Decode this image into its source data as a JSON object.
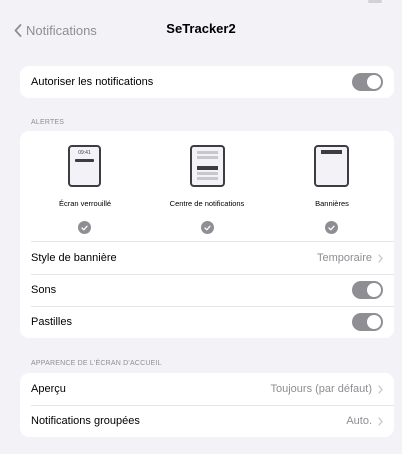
{
  "nav": {
    "back_label": "Notifications",
    "title": "SeTracker2"
  },
  "allow": {
    "label": "Autoriser les notifications",
    "enabled": true
  },
  "alerts": {
    "header": "ALERTES",
    "options": [
      {
        "label": "Écran verrouillé",
        "selected": true,
        "preview_time": "09:41"
      },
      {
        "label": "Centre de notifications",
        "selected": true
      },
      {
        "label": "Bannières",
        "selected": true
      }
    ],
    "banner_style": {
      "label": "Style de bannière",
      "value": "Temporaire"
    },
    "sounds": {
      "label": "Sons",
      "enabled": true
    },
    "badges": {
      "label": "Pastilles",
      "enabled": true
    }
  },
  "home_screen": {
    "header": "APPARENCE DE L'ÉCRAN D'ACCUEIL",
    "preview": {
      "label": "Aperçu",
      "value": "Toujours (par défaut)"
    },
    "grouped": {
      "label": "Notifications groupées",
      "value": "Auto."
    }
  },
  "colors": {
    "background": "#f2f2f7",
    "toggle_on": "#8e8e93",
    "secondary_text": "#8e8e93"
  }
}
